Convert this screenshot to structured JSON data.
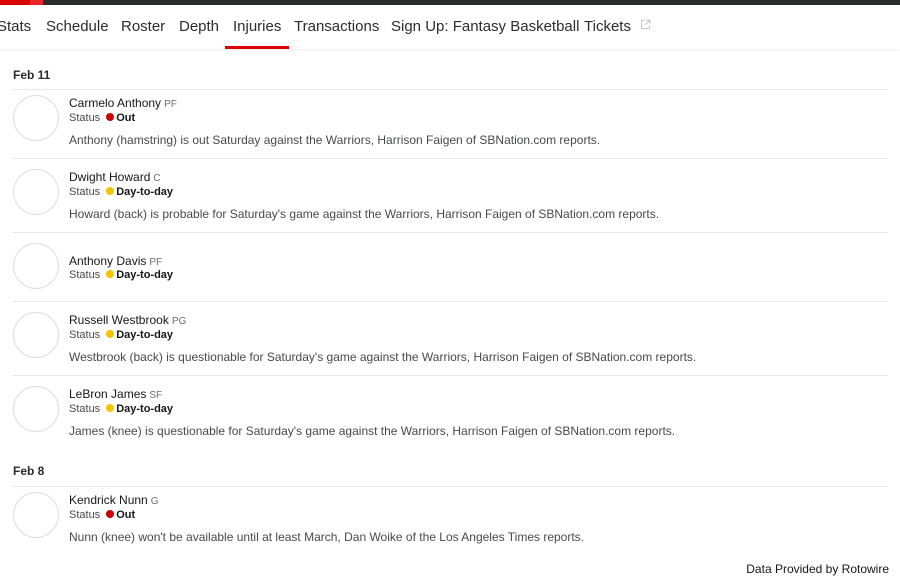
{
  "nav": {
    "items": [
      {
        "label": "Stats"
      },
      {
        "label": "Schedule"
      },
      {
        "label": "Roster"
      },
      {
        "label": "Depth"
      },
      {
        "label": "Injuries",
        "active": true
      },
      {
        "label": "Transactions"
      },
      {
        "label": "Sign Up: Fantasy Basketball"
      },
      {
        "label": "Tickets",
        "external": true
      }
    ]
  },
  "colors": {
    "accent": "#dd0000",
    "status_out": "#cc0000",
    "status_day_to_day": "#f5c400"
  },
  "status_label": "Status",
  "groups": [
    {
      "date": "Feb 11",
      "players": [
        {
          "name": "Carmelo Anthony",
          "position": "PF",
          "status": "Out",
          "status_color": "#cc0000",
          "note": "Anthony (hamstring) is out Saturday against the Warriors, Harrison Faigen of SBNation.com reports."
        },
        {
          "name": "Dwight Howard",
          "position": "C",
          "status": "Day-to-day",
          "status_color": "#f5c400",
          "note": "Howard (back) is probable for Saturday's game against the Warriors, Harrison Faigen of SBNation.com reports."
        },
        {
          "name": "Anthony Davis",
          "position": "PF",
          "status": "Day-to-day",
          "status_color": "#f5c400",
          "note": ""
        },
        {
          "name": "Russell Westbrook",
          "position": "PG",
          "status": "Day-to-day",
          "status_color": "#f5c400",
          "note": "Westbrook (back) is questionable for Saturday's game against the Warriors, Harrison Faigen of SBNation.com reports."
        },
        {
          "name": "LeBron James",
          "position": "SF",
          "status": "Day-to-day",
          "status_color": "#f5c400",
          "note": "James (knee) is questionable for Saturday's game against the Warriors, Harrison Faigen of SBNation.com reports."
        }
      ]
    },
    {
      "date": "Feb 8",
      "players": [
        {
          "name": "Kendrick Nunn",
          "position": "G",
          "status": "Out",
          "status_color": "#cc0000",
          "note": "Nunn (knee) won't be available until at least March, Dan Woike of the Los Angeles Times reports."
        }
      ]
    }
  ],
  "footer": {
    "credit": "Data Provided by Rotowire"
  }
}
